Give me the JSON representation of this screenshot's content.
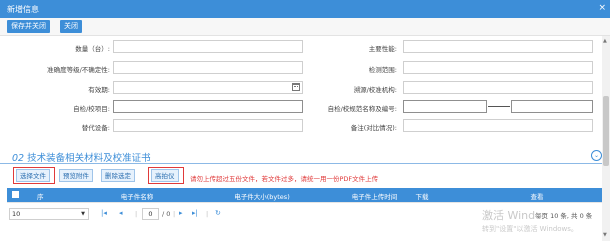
{
  "window": {
    "title": "新增信息",
    "close_icon": "×"
  },
  "toolbar": {
    "save_close": "保存并关闭",
    "close": "关闭"
  },
  "form": {
    "left_labels": [
      "数量（台）:",
      "准确度等级/不确定性:",
      "有效期:",
      "自检/校项目:",
      "替代设备:"
    ],
    "right_labels": [
      "主要性能:",
      "检测范围:",
      "溯源/校准机构:",
      "自检/校规范名称及编号:",
      "备注(对比情况):"
    ]
  },
  "section": {
    "number": "02",
    "title": "技术装备相关材料及校准证书",
    "collapse_icon": "⌄"
  },
  "attachments": {
    "buttons": [
      "选择文件",
      "预览附件",
      "删除选定",
      "高拍仪"
    ],
    "warning": "请勿上传超过五份文件，若文件过多，请统一用一份PDF文件上传"
  },
  "table": {
    "columns": [
      "序",
      "电子件名称",
      "电子件大小(bytes)",
      "电子件上传时间",
      "下载",
      "查看"
    ]
  },
  "pager": {
    "page_size": "10",
    "current_page": "0",
    "total_pages": "/ 0",
    "summary": "每页 10 条, 共 0 条"
  },
  "watermark": {
    "line1": "激活 Windo",
    "line2": "转到\"设置\"以激活 Windows。"
  }
}
